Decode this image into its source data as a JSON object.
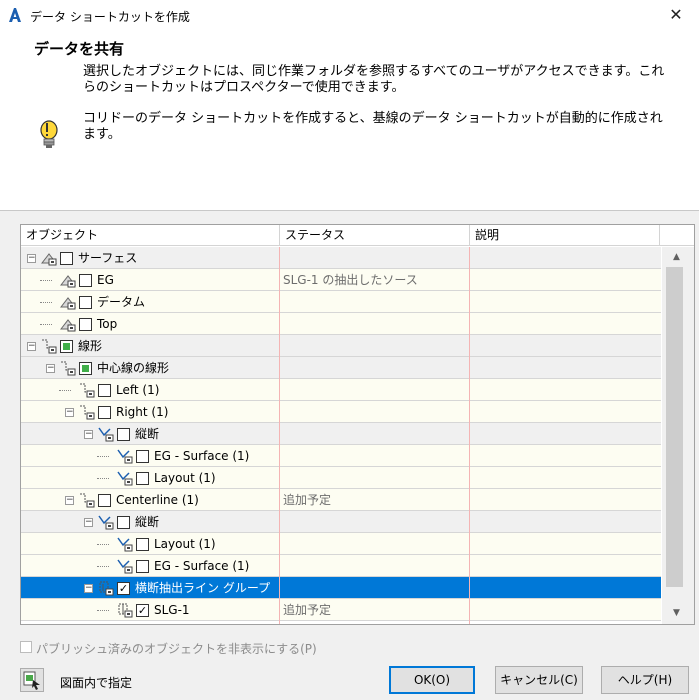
{
  "window": {
    "title": "データ ショートカットを作成",
    "close_glyph": "✕"
  },
  "header": {
    "title": "データを共有",
    "description": "選択したオブジェクトには、同じ作業フォルダを参照するすべてのユーザがアクセスできます。これらのショートカットはプロスペクターで使用できます。",
    "note": "コリドーのデータ ショートカットを作成すると、基線のデータ ショートカットが自動的に作成されます。"
  },
  "table": {
    "columns": [
      "オブジェクト",
      "ステータス",
      "説明"
    ],
    "rows": [
      {
        "name": "サーフェス",
        "status": "",
        "icon": "surface-icon",
        "check": "none",
        "level": 0,
        "expander": "minus",
        "style": "gray"
      },
      {
        "name": "EG",
        "status": "SLG-1 の抽出したソース",
        "icon": "surface-icon",
        "check": "none",
        "level": 1,
        "expander": "",
        "style": "cream"
      },
      {
        "name": "データム",
        "status": "",
        "icon": "surface-icon",
        "check": "none",
        "level": 1,
        "expander": "",
        "style": "cream"
      },
      {
        "name": "Top",
        "status": "",
        "icon": "surface-icon",
        "check": "none",
        "level": 1,
        "expander": "",
        "style": "cream"
      },
      {
        "name": "線形",
        "status": "",
        "icon": "alignment-icon",
        "check": "indeterminate",
        "level": 0,
        "expander": "minus",
        "style": "gray"
      },
      {
        "name": "中心線の線形",
        "status": "",
        "icon": "alignment-icon",
        "check": "indeterminate",
        "level": 1,
        "expander": "minus",
        "style": "gray"
      },
      {
        "name": "Left (1)",
        "status": "",
        "icon": "alignment-icon",
        "check": "none",
        "level": 2,
        "expander": "",
        "style": "cream"
      },
      {
        "name": "Right (1)",
        "status": "",
        "icon": "alignment-icon",
        "check": "none",
        "level": 2,
        "expander": "minus",
        "style": "cream"
      },
      {
        "name": "縦断",
        "status": "",
        "icon": "profile-icon",
        "check": "none",
        "level": 3,
        "expander": "minus",
        "style": "gray"
      },
      {
        "name": "EG - Surface (1)",
        "status": "",
        "icon": "profile-icon",
        "check": "none",
        "level": 4,
        "expander": "",
        "style": "cream"
      },
      {
        "name": "Layout (1)",
        "status": "",
        "icon": "profile-icon",
        "check": "none",
        "level": 4,
        "expander": "",
        "style": "cream"
      },
      {
        "name": "Centerline (1)",
        "status": "追加予定",
        "icon": "alignment-icon",
        "check": "none",
        "level": 2,
        "expander": "minus",
        "style": "cream"
      },
      {
        "name": "縦断",
        "status": "",
        "icon": "profile-icon",
        "check": "none",
        "level": 3,
        "expander": "minus",
        "style": "gray"
      },
      {
        "name": "Layout (1)",
        "status": "",
        "icon": "profile-icon",
        "check": "none",
        "level": 4,
        "expander": "",
        "style": "cream"
      },
      {
        "name": "EG - Surface (1)",
        "status": "",
        "icon": "profile-icon",
        "check": "none",
        "level": 4,
        "expander": "",
        "style": "cream"
      },
      {
        "name": "横断抽出ライン グループ",
        "status": "",
        "icon": "sample-line-group-icon",
        "check": "checked",
        "level": 3,
        "expander": "minus",
        "style": "selected"
      },
      {
        "name": "SLG-1",
        "status": "追加予定",
        "icon": "sample-line-icon",
        "check": "checked",
        "level": 4,
        "expander": "",
        "style": "cream"
      }
    ]
  },
  "footer": {
    "hide_published_label": "パブリッシュ済みのオブジェクトを非表示にする(P)",
    "select_in_drawing_label": "図面内で指定",
    "ok_label": "OK(O)",
    "cancel_label": "キャンセル(C)",
    "help_label": "ヘルプ(H)"
  },
  "colors": {
    "selection": "#0078d7",
    "indeterminate_check": "#3fae49",
    "row_cream": "#fdfdf2",
    "row_gray": "#f0f0f0"
  }
}
